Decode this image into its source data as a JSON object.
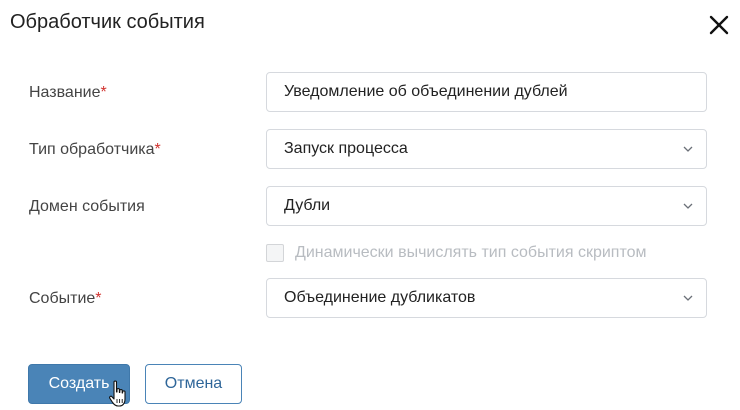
{
  "dialog": {
    "title": "Обработчик события",
    "close_icon": "close-icon"
  },
  "form": {
    "name": {
      "label": "Название",
      "required_mark": "*",
      "value": "Уведомление об объединении дублей"
    },
    "handler_type": {
      "label": "Тип обработчика",
      "required_mark": "*",
      "value": "Запуск процесса"
    },
    "event_domain": {
      "label": "Домен события",
      "value": "Дубли"
    },
    "dynamic_checkbox": {
      "label": "Динамически вычислять тип события скриптом",
      "checked": false,
      "disabled": true
    },
    "event": {
      "label": "Событие",
      "required_mark": "*",
      "value": "Объединение дубликатов"
    }
  },
  "buttons": {
    "create_label": "Создать",
    "cancel_label": "Отмена"
  },
  "colors": {
    "primary": "#4a84b7",
    "required": "#d0312d",
    "disabled_text": "#b8bcc1"
  }
}
